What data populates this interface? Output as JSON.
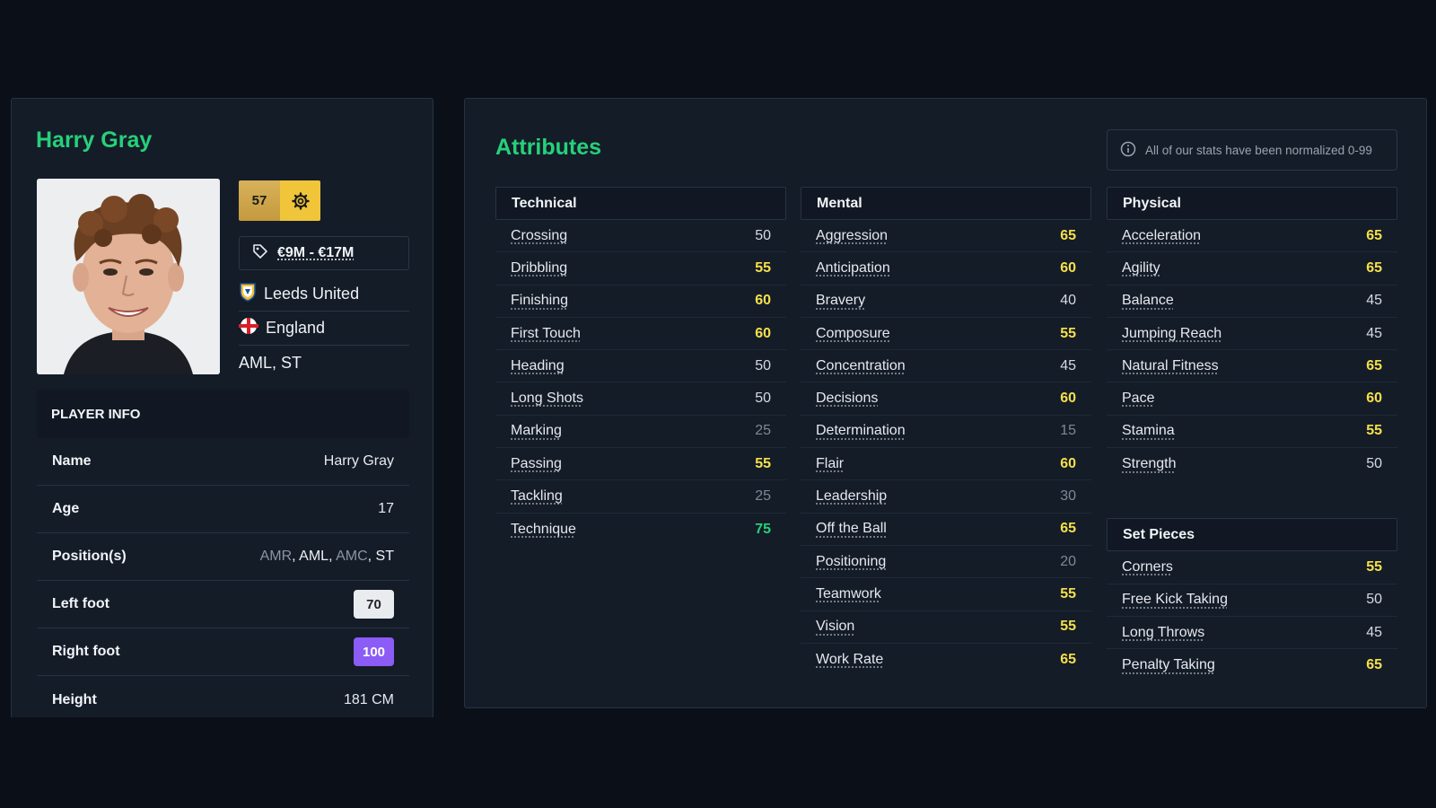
{
  "player": {
    "name": "Harry Gray",
    "rating": "57",
    "value": "€9M - €17M",
    "club": "Leeds United",
    "nation": "England",
    "positions": "AML, ST"
  },
  "player_info": {
    "header": "PLAYER INFO",
    "rows": {
      "name_label": "Name",
      "name_value": "Harry Gray",
      "age_label": "Age",
      "age_value": "17",
      "positions_label": "Position(s)",
      "positions": [
        {
          "text": "AMR",
          "main": false
        },
        {
          "text": "AML",
          "main": true
        },
        {
          "text": "AMC",
          "main": false
        },
        {
          "text": "ST",
          "main": true
        }
      ],
      "left_foot_label": "Left foot",
      "left_foot_value": "70",
      "right_foot_label": "Right foot",
      "right_foot_value": "100",
      "height_label": "Height",
      "height_value": "181 CM"
    }
  },
  "attributes": {
    "title": "Attributes",
    "note": "All of our stats have been normalized 0-99",
    "technical": {
      "label": "Technical",
      "items": [
        {
          "name": "Crossing",
          "value": "50",
          "tone": "normal"
        },
        {
          "name": "Dribbling",
          "value": "55",
          "tone": "yellow"
        },
        {
          "name": "Finishing",
          "value": "60",
          "tone": "yellow"
        },
        {
          "name": "First Touch",
          "value": "60",
          "tone": "yellow"
        },
        {
          "name": "Heading",
          "value": "50",
          "tone": "normal"
        },
        {
          "name": "Long Shots",
          "value": "50",
          "tone": "normal"
        },
        {
          "name": "Marking",
          "value": "25",
          "tone": "dim"
        },
        {
          "name": "Passing",
          "value": "55",
          "tone": "yellow"
        },
        {
          "name": "Tackling",
          "value": "25",
          "tone": "dim"
        },
        {
          "name": "Technique",
          "value": "75",
          "tone": "green"
        }
      ]
    },
    "mental": {
      "label": "Mental",
      "items": [
        {
          "name": "Aggression",
          "value": "65",
          "tone": "yellow"
        },
        {
          "name": "Anticipation",
          "value": "60",
          "tone": "yellow"
        },
        {
          "name": "Bravery",
          "value": "40",
          "tone": "normal"
        },
        {
          "name": "Composure",
          "value": "55",
          "tone": "yellow"
        },
        {
          "name": "Concentration",
          "value": "45",
          "tone": "normal"
        },
        {
          "name": "Decisions",
          "value": "60",
          "tone": "yellow"
        },
        {
          "name": "Determination",
          "value": "15",
          "tone": "dim"
        },
        {
          "name": "Flair",
          "value": "60",
          "tone": "yellow"
        },
        {
          "name": "Leadership",
          "value": "30",
          "tone": "dim"
        },
        {
          "name": "Off the Ball",
          "value": "65",
          "tone": "yellow"
        },
        {
          "name": "Positioning",
          "value": "20",
          "tone": "dim"
        },
        {
          "name": "Teamwork",
          "value": "55",
          "tone": "yellow"
        },
        {
          "name": "Vision",
          "value": "55",
          "tone": "yellow"
        },
        {
          "name": "Work Rate",
          "value": "65",
          "tone": "yellow"
        }
      ]
    },
    "physical": {
      "label": "Physical",
      "items": [
        {
          "name": "Acceleration",
          "value": "65",
          "tone": "yellow"
        },
        {
          "name": "Agility",
          "value": "65",
          "tone": "yellow"
        },
        {
          "name": "Balance",
          "value": "45",
          "tone": "normal"
        },
        {
          "name": "Jumping Reach",
          "value": "45",
          "tone": "normal"
        },
        {
          "name": "Natural Fitness",
          "value": "65",
          "tone": "yellow"
        },
        {
          "name": "Pace",
          "value": "60",
          "tone": "yellow"
        },
        {
          "name": "Stamina",
          "value": "55",
          "tone": "yellow"
        },
        {
          "name": "Strength",
          "value": "50",
          "tone": "normal"
        }
      ]
    },
    "set_pieces": {
      "label": "Set Pieces",
      "items": [
        {
          "name": "Corners",
          "value": "55",
          "tone": "yellow"
        },
        {
          "name": "Free Kick Taking",
          "value": "50",
          "tone": "normal"
        },
        {
          "name": "Long Throws",
          "value": "45",
          "tone": "normal"
        },
        {
          "name": "Penalty Taking",
          "value": "65",
          "tone": "yellow"
        }
      ]
    }
  },
  "colors": {
    "accent_green": "#27d07a",
    "value_yellow": "#f5e04a",
    "rating_gold": "#d9b15a",
    "right_foot_purple": "#8b5cf6",
    "card_bg": "#141c28",
    "page_bg": "#0b0f17"
  },
  "icons": {
    "settings": "gear-icon",
    "value": "price-tag-icon",
    "club": "leeds-crest-icon",
    "nation": "england-flag-icon",
    "note": "info-icon"
  }
}
